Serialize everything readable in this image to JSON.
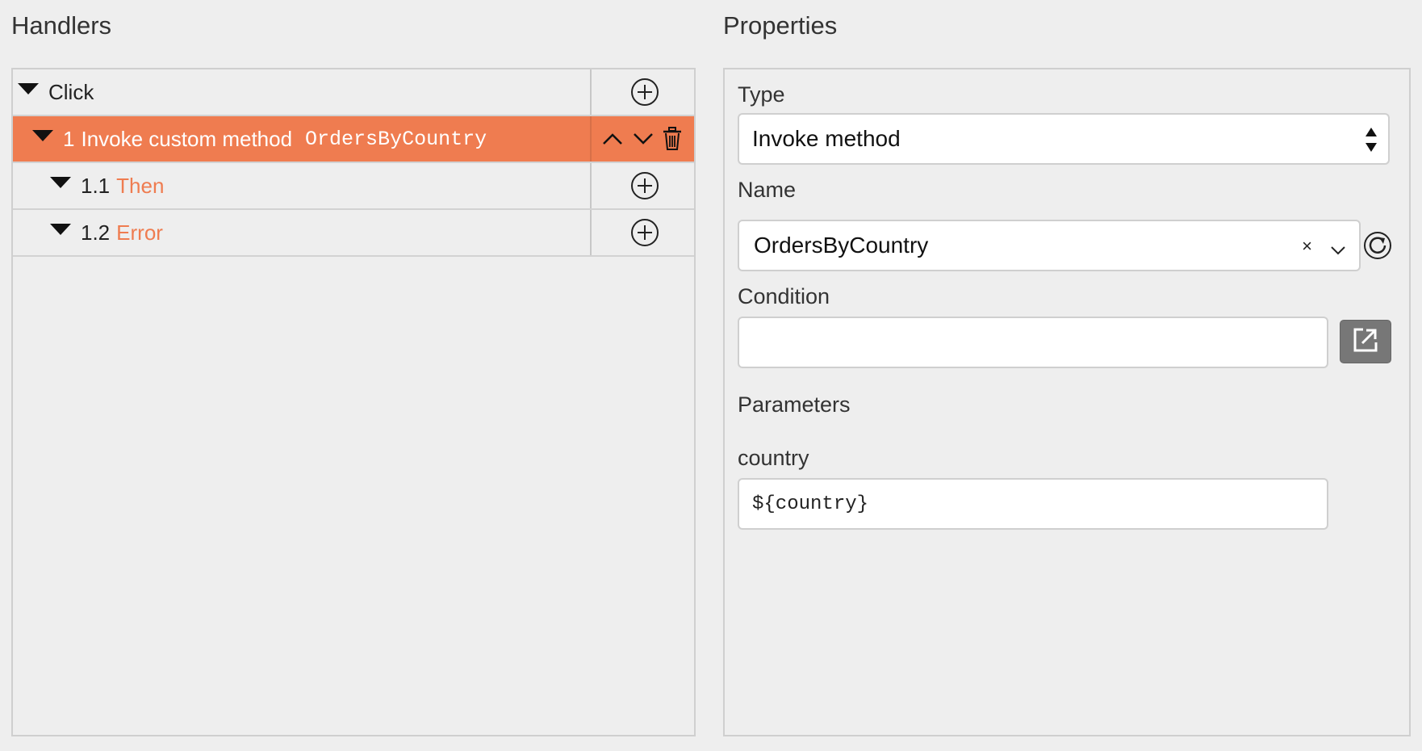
{
  "handlers": {
    "title": "Handlers",
    "rows": [
      {
        "number": "",
        "label": "Click",
        "level": 0
      },
      {
        "number": "1",
        "label": "Invoke custom method",
        "method": "OrdersByCountry",
        "level": 1,
        "selected": true
      },
      {
        "number": "1.1",
        "label": "Then",
        "level": 2
      },
      {
        "number": "1.2",
        "label": "Error",
        "level": 2
      }
    ]
  },
  "properties": {
    "title": "Properties",
    "type_label": "Type",
    "type_value": "Invoke method",
    "name_label": "Name",
    "name_value": "OrdersByCountry",
    "clear_symbol": "×",
    "condition_label": "Condition",
    "condition_value": "",
    "parameters_label": "Parameters",
    "parameter_name": "country",
    "parameter_value": "${country}"
  },
  "colors": {
    "accent": "#ef7c50",
    "background": "#eeeeee",
    "border": "#cfcfcf"
  }
}
